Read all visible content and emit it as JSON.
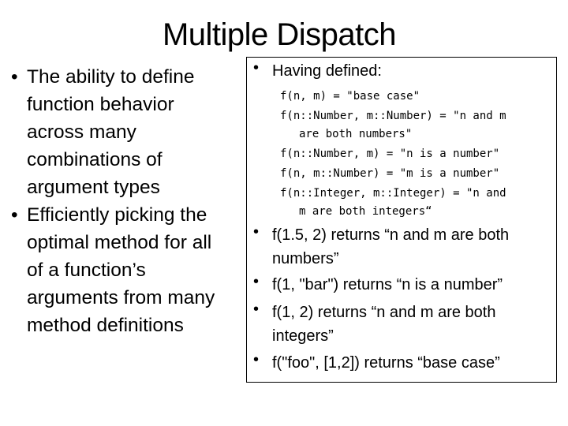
{
  "title": "Multiple Dispatch",
  "bullet_glyph": "•",
  "left_bullets": [
    {
      "lines": [
        "The ability to define",
        "function behavior",
        "across many",
        "combinations of",
        "argument types"
      ]
    },
    {
      "lines": [
        "Efficiently picking the",
        "optimal method for all",
        "of a function’s",
        "arguments from many",
        "method definitions"
      ]
    }
  ],
  "box": {
    "heading": "Having defined:",
    "code": [
      {
        "line": "f(n, m) = \"base case\""
      },
      {
        "line": "f(n::Number, m::Number) = \"n and m",
        "cont": "are both numbers\""
      },
      {
        "line": "f(n::Number, m) = \"n is a number\""
      },
      {
        "line": "f(n, m::Number) = \"m is a number\""
      },
      {
        "line": "f(n::Integer, m::Integer) = \"n and",
        "cont": "m are both integers“"
      }
    ],
    "examples": [
      {
        "lines": [
          "f(1.5, 2) returns “n and m are both",
          "numbers”"
        ]
      },
      {
        "lines": [
          "f(1, \"bar\") returns “n is a number”"
        ]
      },
      {
        "lines": [
          "f(1, 2) returns “n and m are both",
          "integers”"
        ]
      },
      {
        "lines": [
          "f(\"foo\", [1,2]) returns “base case”"
        ]
      }
    ]
  }
}
